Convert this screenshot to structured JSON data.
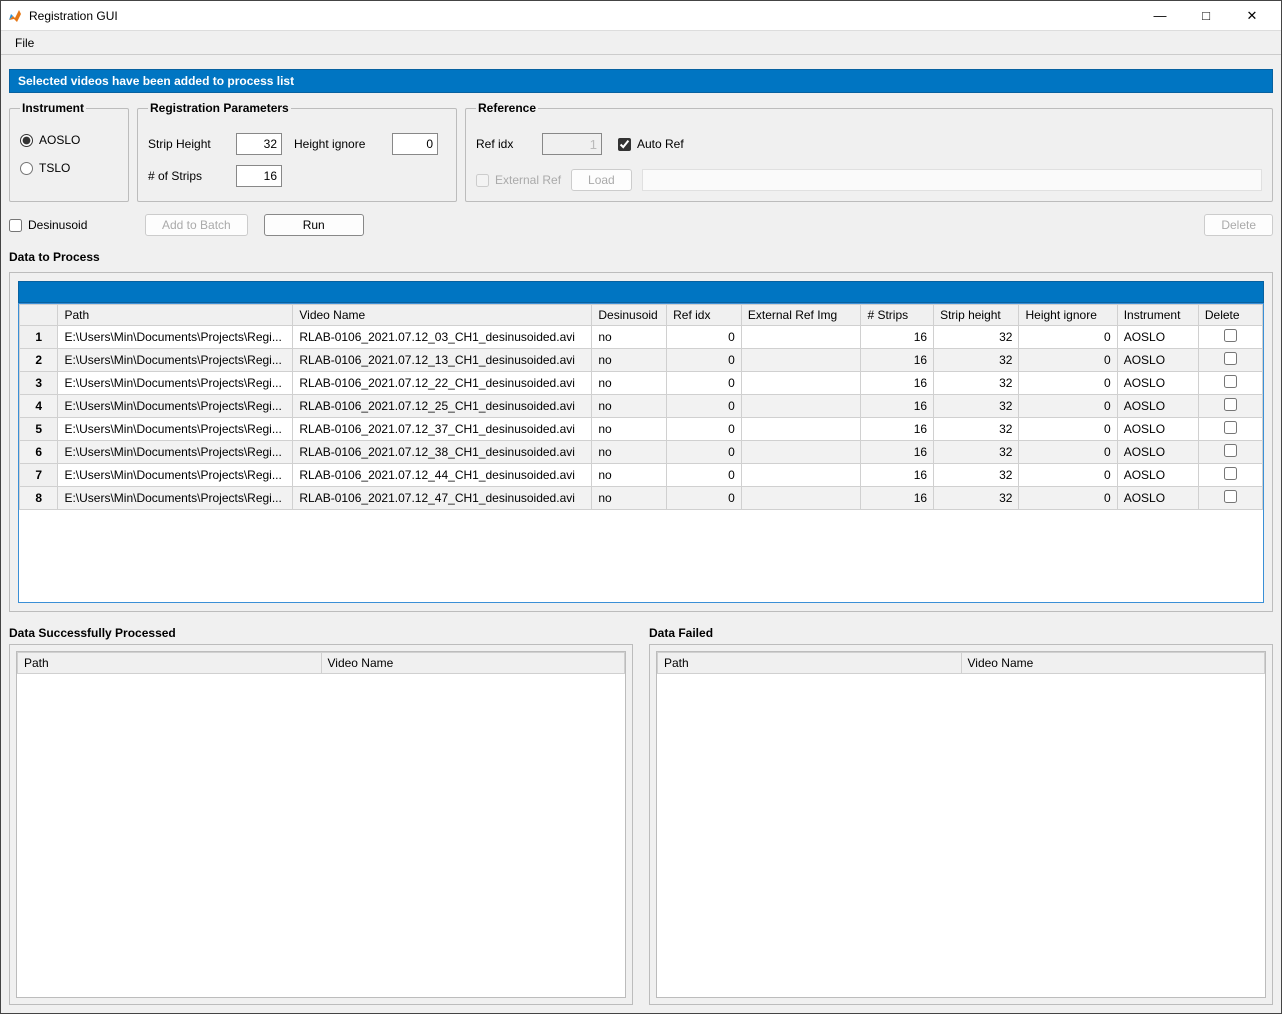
{
  "window": {
    "title": "Registration GUI",
    "menu": {
      "file": "File"
    },
    "buttons": {
      "minimize": "—",
      "maximize": "□",
      "close": "✕"
    }
  },
  "banner": "Selected videos have been added to process list",
  "instrument": {
    "legend": "Instrument",
    "options": {
      "aoslo": "AOSLO",
      "tslo": "TSLO"
    },
    "selected": "aoslo"
  },
  "registration_params": {
    "legend": "Registration Parameters",
    "strip_height_label": "Strip Height",
    "strip_height": "32",
    "height_ignore_label": "Height ignore",
    "height_ignore": "0",
    "n_strips_label": "# of Strips",
    "n_strips": "16"
  },
  "reference": {
    "legend": "Reference",
    "ref_idx_label": "Ref idx",
    "ref_idx": "1",
    "auto_ref_label": "Auto Ref",
    "auto_ref_checked": true,
    "external_ref_label": "External Ref",
    "load_label": "Load"
  },
  "actions": {
    "desinusoid_label": "Desinusoid",
    "add_to_batch": "Add to Batch",
    "run": "Run",
    "delete": "Delete"
  },
  "data_to_process": {
    "title": "Data to Process",
    "headers": {
      "path": "Path",
      "video": "Video Name",
      "desinusoid": "Desinusoid",
      "ref_idx": "Ref idx",
      "ext_ref": "External Ref Img",
      "n_strips": "# Strips",
      "strip_height": "Strip height",
      "height_ignore": "Height ignore",
      "instrument": "Instrument",
      "delete": "Delete"
    },
    "rows": [
      {
        "idx": "1",
        "path": "E:\\Users\\Min\\Documents\\Projects\\Regi...",
        "video": "RLAB-0106_2021.07.12_03_CH1_desinusoided.avi",
        "desinusoid": "no",
        "ref_idx": "0",
        "ext_ref": "",
        "n_strips": "16",
        "strip_height": "32",
        "height_ignore": "0",
        "instrument": "AOSLO"
      },
      {
        "idx": "2",
        "path": "E:\\Users\\Min\\Documents\\Projects\\Regi...",
        "video": "RLAB-0106_2021.07.12_13_CH1_desinusoided.avi",
        "desinusoid": "no",
        "ref_idx": "0",
        "ext_ref": "",
        "n_strips": "16",
        "strip_height": "32",
        "height_ignore": "0",
        "instrument": "AOSLO"
      },
      {
        "idx": "3",
        "path": "E:\\Users\\Min\\Documents\\Projects\\Regi...",
        "video": "RLAB-0106_2021.07.12_22_CH1_desinusoided.avi",
        "desinusoid": "no",
        "ref_idx": "0",
        "ext_ref": "",
        "n_strips": "16",
        "strip_height": "32",
        "height_ignore": "0",
        "instrument": "AOSLO"
      },
      {
        "idx": "4",
        "path": "E:\\Users\\Min\\Documents\\Projects\\Regi...",
        "video": "RLAB-0106_2021.07.12_25_CH1_desinusoided.avi",
        "desinusoid": "no",
        "ref_idx": "0",
        "ext_ref": "",
        "n_strips": "16",
        "strip_height": "32",
        "height_ignore": "0",
        "instrument": "AOSLO"
      },
      {
        "idx": "5",
        "path": "E:\\Users\\Min\\Documents\\Projects\\Regi...",
        "video": "RLAB-0106_2021.07.12_37_CH1_desinusoided.avi",
        "desinusoid": "no",
        "ref_idx": "0",
        "ext_ref": "",
        "n_strips": "16",
        "strip_height": "32",
        "height_ignore": "0",
        "instrument": "AOSLO"
      },
      {
        "idx": "6",
        "path": "E:\\Users\\Min\\Documents\\Projects\\Regi...",
        "video": "RLAB-0106_2021.07.12_38_CH1_desinusoided.avi",
        "desinusoid": "no",
        "ref_idx": "0",
        "ext_ref": "",
        "n_strips": "16",
        "strip_height": "32",
        "height_ignore": "0",
        "instrument": "AOSLO"
      },
      {
        "idx": "7",
        "path": "E:\\Users\\Min\\Documents\\Projects\\Regi...",
        "video": "RLAB-0106_2021.07.12_44_CH1_desinusoided.avi",
        "desinusoid": "no",
        "ref_idx": "0",
        "ext_ref": "",
        "n_strips": "16",
        "strip_height": "32",
        "height_ignore": "0",
        "instrument": "AOSLO"
      },
      {
        "idx": "8",
        "path": "E:\\Users\\Min\\Documents\\Projects\\Regi...",
        "video": "RLAB-0106_2021.07.12_47_CH1_desinusoided.avi",
        "desinusoid": "no",
        "ref_idx": "0",
        "ext_ref": "",
        "n_strips": "16",
        "strip_height": "32",
        "height_ignore": "0",
        "instrument": "AOSLO"
      }
    ]
  },
  "processed": {
    "title": "Data Successfully Processed",
    "headers": {
      "path": "Path",
      "video": "Video Name"
    }
  },
  "failed": {
    "title": "Data Failed",
    "headers": {
      "path": "Path",
      "video": "Video Name"
    }
  }
}
